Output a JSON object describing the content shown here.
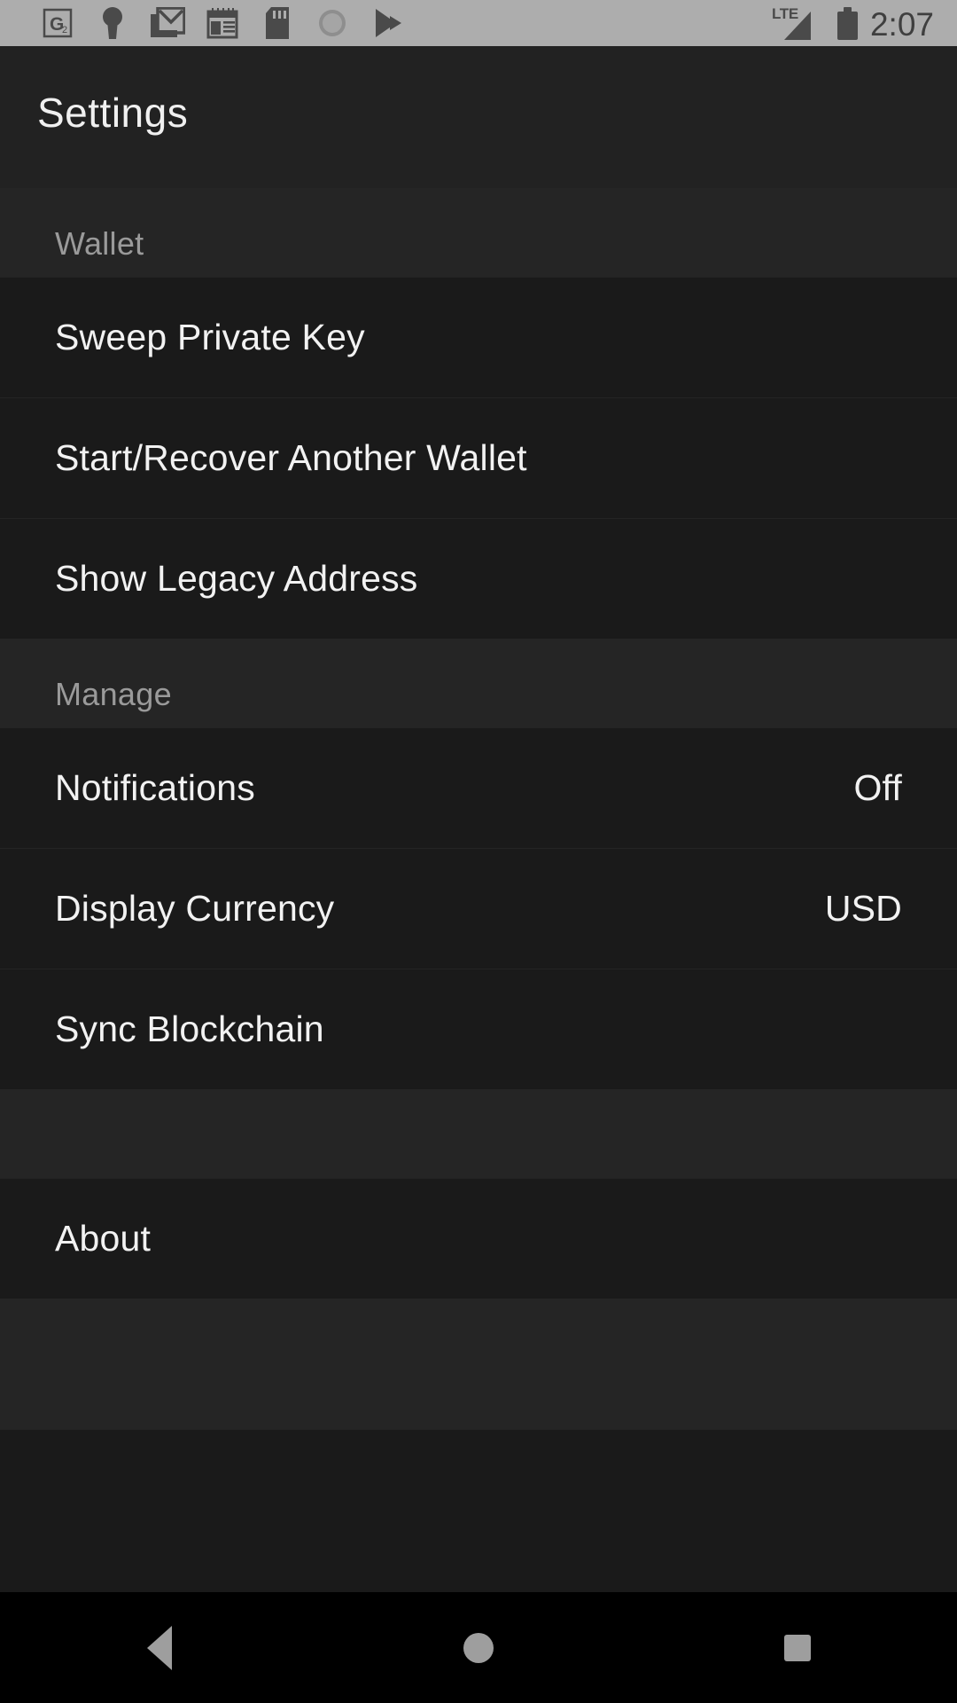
{
  "statusbar": {
    "icons": [
      {
        "name": "g2-app-icon",
        "glyph": "G"
      },
      {
        "name": "keyhole-icon",
        "glyph": "keyhole"
      },
      {
        "name": "gmail-icon",
        "glyph": "M"
      },
      {
        "name": "calendar-icon",
        "glyph": "calendar"
      },
      {
        "name": "sd-card-icon",
        "glyph": "sdcard"
      },
      {
        "name": "sync-circle-icon",
        "glyph": "circle"
      },
      {
        "name": "play-store-icon",
        "glyph": "play"
      }
    ],
    "network_label": "LTE",
    "battery_label": "battery-full",
    "clock": "2:07"
  },
  "appbar": {
    "title": "Settings"
  },
  "sections": [
    {
      "header": "Wallet",
      "items": [
        {
          "label": "Sweep Private Key",
          "value": ""
        },
        {
          "label": "Start/Recover Another Wallet",
          "value": ""
        },
        {
          "label": "Show Legacy Address",
          "value": ""
        }
      ]
    },
    {
      "header": "Manage",
      "items": [
        {
          "label": "Notifications",
          "value": "Off"
        },
        {
          "label": "Display Currency",
          "value": "USD"
        },
        {
          "label": "Sync Blockchain",
          "value": ""
        }
      ]
    },
    {
      "header": "",
      "items": [
        {
          "label": "About",
          "value": ""
        }
      ]
    }
  ],
  "navbar": {
    "back_label": "Back",
    "home_label": "Home",
    "recents_label": "Recents"
  },
  "colors": {
    "statusbar_bg": "#adadad",
    "appbar_bg": "#222222",
    "section_bg": "#252525",
    "row_bg": "#1a1a1a",
    "text_primary": "#f2f2f2",
    "text_secondary": "#9a9a9a",
    "navbar_bg": "#000000",
    "nav_icon": "#9e9e9e"
  }
}
